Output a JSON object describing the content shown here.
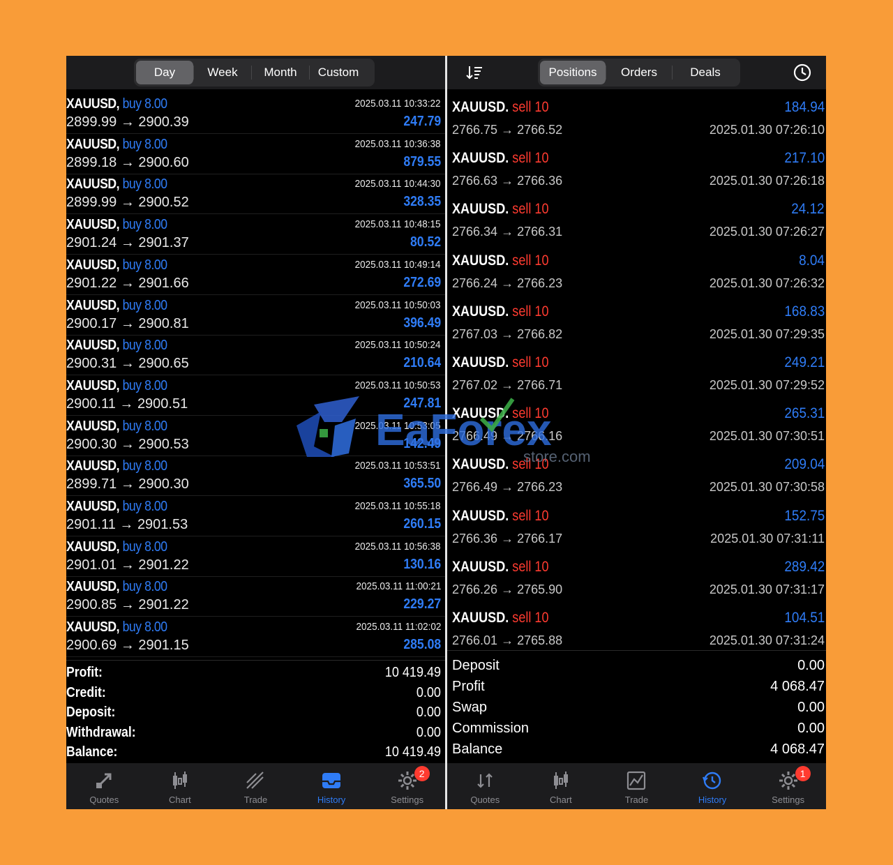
{
  "left": {
    "tabs": [
      "Day",
      "Week",
      "Month",
      "Custom"
    ],
    "active_tab": 0,
    "deals": [
      {
        "symbol": "XAUUSD,",
        "side": "buy 8.00",
        "open": "2899.99",
        "close": "2900.39",
        "time": "2025.03.11 10:33:22",
        "profit": "247.79"
      },
      {
        "symbol": "XAUUSD,",
        "side": "buy 8.00",
        "open": "2899.18",
        "close": "2900.60",
        "time": "2025.03.11 10:36:38",
        "profit": "879.55"
      },
      {
        "symbol": "XAUUSD,",
        "side": "buy 8.00",
        "open": "2899.99",
        "close": "2900.52",
        "time": "2025.03.11 10:44:30",
        "profit": "328.35"
      },
      {
        "symbol": "XAUUSD,",
        "side": "buy 8.00",
        "open": "2901.24",
        "close": "2901.37",
        "time": "2025.03.11 10:48:15",
        "profit": "80.52"
      },
      {
        "symbol": "XAUUSD,",
        "side": "buy 8.00",
        "open": "2901.22",
        "close": "2901.66",
        "time": "2025.03.11 10:49:14",
        "profit": "272.69"
      },
      {
        "symbol": "XAUUSD,",
        "side": "buy 8.00",
        "open": "2900.17",
        "close": "2900.81",
        "time": "2025.03.11 10:50:03",
        "profit": "396.49"
      },
      {
        "symbol": "XAUUSD,",
        "side": "buy 8.00",
        "open": "2900.31",
        "close": "2900.65",
        "time": "2025.03.11 10:50:24",
        "profit": "210.64"
      },
      {
        "symbol": "XAUUSD,",
        "side": "buy 8.00",
        "open": "2900.11",
        "close": "2900.51",
        "time": "2025.03.11 10:50:53",
        "profit": "247.81"
      },
      {
        "symbol": "XAUUSD,",
        "side": "buy 8.00",
        "open": "2900.30",
        "close": "2900.53",
        "time": "2025.03.11 10:53:05",
        "profit": "142.49"
      },
      {
        "symbol": "XAUUSD,",
        "side": "buy 8.00",
        "open": "2899.71",
        "close": "2900.30",
        "time": "2025.03.11 10:53:51",
        "profit": "365.50"
      },
      {
        "symbol": "XAUUSD,",
        "side": "buy 8.00",
        "open": "2901.11",
        "close": "2901.53",
        "time": "2025.03.11 10:55:18",
        "profit": "260.15"
      },
      {
        "symbol": "XAUUSD,",
        "side": "buy 8.00",
        "open": "2901.01",
        "close": "2901.22",
        "time": "2025.03.11 10:56:38",
        "profit": "130.16"
      },
      {
        "symbol": "XAUUSD,",
        "side": "buy 8.00",
        "open": "2900.85",
        "close": "2901.22",
        "time": "2025.03.11 11:00:21",
        "profit": "229.27"
      },
      {
        "symbol": "XAUUSD,",
        "side": "buy 8.00",
        "open": "2900.69",
        "close": "2901.15",
        "time": "2025.03.11 11:02:02",
        "profit": "285.08"
      }
    ],
    "summary": [
      {
        "label": "Profit:",
        "value": "10 419.49"
      },
      {
        "label": "Credit:",
        "value": "0.00"
      },
      {
        "label": "Deposit:",
        "value": "0.00"
      },
      {
        "label": "Withdrawal:",
        "value": "0.00"
      },
      {
        "label": "Balance:",
        "value": "10 419.49"
      }
    ],
    "tabbar": [
      {
        "label": "Quotes",
        "icon": "quotes-icon"
      },
      {
        "label": "Chart",
        "icon": "candles-icon"
      },
      {
        "label": "Trade",
        "icon": "trade-icon"
      },
      {
        "label": "History",
        "icon": "history-inbox-icon"
      },
      {
        "label": "Settings",
        "icon": "gear-icon",
        "badge": "2"
      }
    ],
    "active_tabbar": 3
  },
  "right": {
    "tabs": [
      "Positions",
      "Orders",
      "Deals"
    ],
    "active_tab": 0,
    "positions": [
      {
        "symbol": "XAUUSD.",
        "side": "sell 10",
        "open": "2766.75",
        "close": "2766.52",
        "time": "2025.01.30 07:26:10",
        "profit": "184.94"
      },
      {
        "symbol": "XAUUSD.",
        "side": "sell 10",
        "open": "2766.63",
        "close": "2766.36",
        "time": "2025.01.30 07:26:18",
        "profit": "217.10"
      },
      {
        "symbol": "XAUUSD.",
        "side": "sell 10",
        "open": "2766.34",
        "close": "2766.31",
        "time": "2025.01.30 07:26:27",
        "profit": "24.12"
      },
      {
        "symbol": "XAUUSD.",
        "side": "sell 10",
        "open": "2766.24",
        "close": "2766.23",
        "time": "2025.01.30 07:26:32",
        "profit": "8.04"
      },
      {
        "symbol": "XAUUSD.",
        "side": "sell 10",
        "open": "2767.03",
        "close": "2766.82",
        "time": "2025.01.30 07:29:35",
        "profit": "168.83"
      },
      {
        "symbol": "XAUUSD.",
        "side": "sell 10",
        "open": "2767.02",
        "close": "2766.71",
        "time": "2025.01.30 07:29:52",
        "profit": "249.21"
      },
      {
        "symbol": "XAUUSD.",
        "side": "sell 10",
        "open": "2766.49",
        "close": "2766.16",
        "time": "2025.01.30 07:30:51",
        "profit": "265.31"
      },
      {
        "symbol": "XAUUSD.",
        "side": "sell 10",
        "open": "2766.49",
        "close": "2766.23",
        "time": "2025.01.30 07:30:58",
        "profit": "209.04"
      },
      {
        "symbol": "XAUUSD.",
        "side": "sell 10",
        "open": "2766.36",
        "close": "2766.17",
        "time": "2025.01.30 07:31:11",
        "profit": "152.75"
      },
      {
        "symbol": "XAUUSD.",
        "side": "sell 10",
        "open": "2766.26",
        "close": "2765.90",
        "time": "2025.01.30 07:31:17",
        "profit": "289.42"
      },
      {
        "symbol": "XAUUSD.",
        "side": "sell 10",
        "open": "2766.01",
        "close": "2765.88",
        "time": "2025.01.30 07:31:24",
        "profit": "104.51"
      }
    ],
    "summary": [
      {
        "label": "Deposit",
        "value": "0.00"
      },
      {
        "label": "Profit",
        "value": "4 068.47"
      },
      {
        "label": "Swap",
        "value": "0.00"
      },
      {
        "label": "Commission",
        "value": "0.00"
      },
      {
        "label": "Balance",
        "value": "4 068.47"
      }
    ],
    "tabbar": [
      {
        "label": "Quotes",
        "icon": "quotes-arrows-icon"
      },
      {
        "label": "Chart",
        "icon": "candles-icon"
      },
      {
        "label": "Trade",
        "icon": "trade-chart-icon"
      },
      {
        "label": "History",
        "icon": "history-clock-icon"
      },
      {
        "label": "Settings",
        "icon": "gear-icon",
        "badge": "1"
      }
    ],
    "active_tabbar": 3
  },
  "arrow": "→",
  "watermark": {
    "brand": "EaForex",
    "sub": "store.com"
  },
  "colors": {
    "buy": "#2f7cf6",
    "sell": "#ff3b30",
    "profit": "#2f7cf6",
    "background": "#f99c38"
  }
}
